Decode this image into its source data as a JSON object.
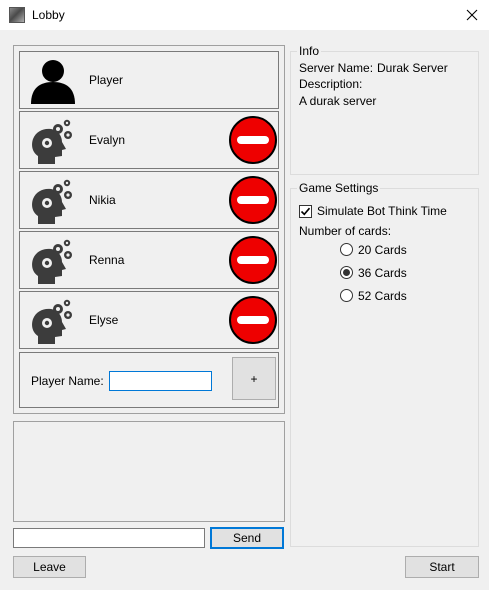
{
  "window": {
    "title": "Lobby"
  },
  "players": [
    {
      "name": "Player",
      "type": "human",
      "kickable": false
    },
    {
      "name": "Evalyn",
      "type": "bot",
      "kickable": true
    },
    {
      "name": "Nikia",
      "type": "bot",
      "kickable": true
    },
    {
      "name": "Renna",
      "type": "bot",
      "kickable": true
    },
    {
      "name": "Elyse",
      "type": "bot",
      "kickable": true
    }
  ],
  "player_name": {
    "label": "Player Name:",
    "value": ""
  },
  "add_button": {
    "label": "+"
  },
  "chat": {
    "input_value": "",
    "send_label": "Send"
  },
  "info": {
    "legend": "Info",
    "server_name_label": "Server Name:",
    "server_name_value": "Durak Server",
    "description_label": "Description:",
    "description_value": "A durak server"
  },
  "settings": {
    "legend": "Game Settings",
    "simulate_label": "Simulate Bot Think Time",
    "simulate_checked": true,
    "cards_label": "Number of cards:",
    "card_options": [
      {
        "label": "20 Cards",
        "selected": false
      },
      {
        "label": "36 Cards",
        "selected": true
      },
      {
        "label": "52 Cards",
        "selected": false
      }
    ]
  },
  "leave_label": "Leave",
  "start_label": "Start",
  "colors": {
    "kick_red": "#ee0000",
    "focus_blue": "#0078d7",
    "icon_gray": "#3c3c3c"
  }
}
